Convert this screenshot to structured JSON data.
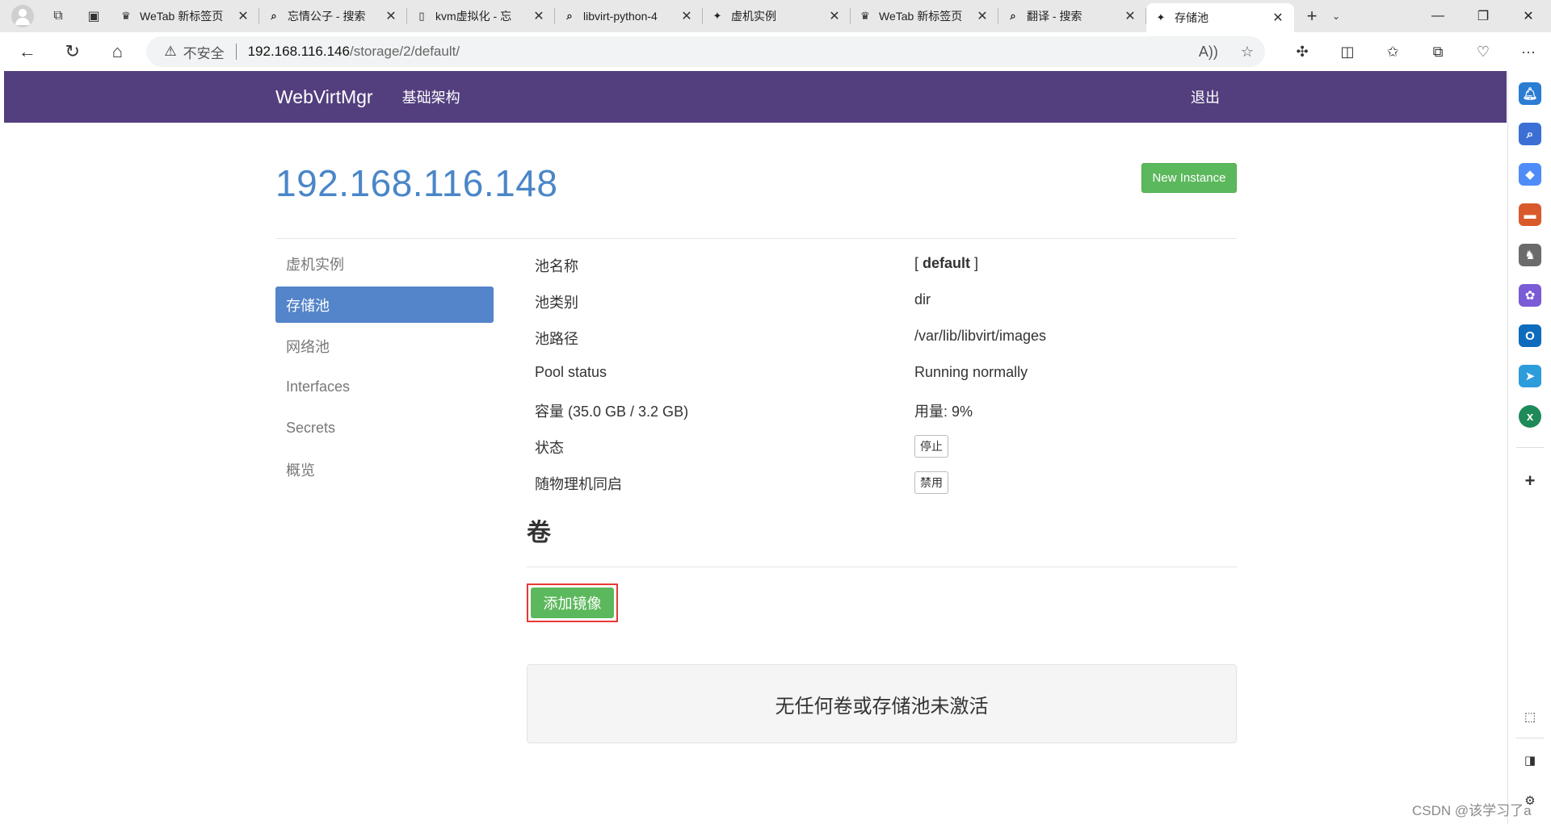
{
  "browser": {
    "tabs": [
      {
        "title": "WeTab 新标签页",
        "icon": "wetab-icon",
        "glyph": "♛"
      },
      {
        "title": "忘情公子 - 搜索",
        "icon": "search-icon",
        "glyph": "⌕"
      },
      {
        "title": "kvm虚拟化 - 忘",
        "icon": "document-icon",
        "glyph": "▯"
      },
      {
        "title": "libvirt-python-4",
        "icon": "search-icon",
        "glyph": "⌕"
      },
      {
        "title": "虚机实例",
        "icon": "webvirtmgr-icon",
        "glyph": "✦"
      },
      {
        "title": "WeTab 新标签页",
        "icon": "wetab-icon",
        "glyph": "♛"
      },
      {
        "title": "翻译 - 搜索",
        "icon": "search-icon",
        "glyph": "⌕"
      },
      {
        "title": "存储池",
        "icon": "webvirtmgr-icon",
        "glyph": "✦",
        "active": true
      }
    ],
    "security_label": "不安全",
    "url_host": "192.168.116.146",
    "url_path": "/storage/2/default/"
  },
  "app": {
    "brand": "WebVirtMgr",
    "nav_infra": "基础架构",
    "logout": "退出",
    "host": "192.168.116.148",
    "new_instance": "New Instance",
    "accent": "#533e7e"
  },
  "sidebar": {
    "items": [
      {
        "label": "虚机实例"
      },
      {
        "label": "存储池",
        "active": true
      },
      {
        "label": "网络池"
      },
      {
        "label": "Interfaces"
      },
      {
        "label": "Secrets"
      },
      {
        "label": "概览"
      }
    ]
  },
  "pool": {
    "name_label": "池名称",
    "name_value": "default",
    "type_label": "池类别",
    "type_value": "dir",
    "path_label": "池路径",
    "path_value": "/var/lib/libvirt/images",
    "status_label": "Pool status",
    "status_value": "Running normally",
    "capacity_label": "容量 (35.0 GB / 3.2 GB)",
    "usage_value": "用量: 9%",
    "state_label": "状态",
    "state_button": "停止",
    "autostart_label": "随物理机同启",
    "autostart_button": "禁用"
  },
  "volumes": {
    "title": "卷",
    "add_button": "添加镜像",
    "empty_message": "无任何卷或存储池未激活"
  },
  "watermark": "CSDN @该学习了a"
}
